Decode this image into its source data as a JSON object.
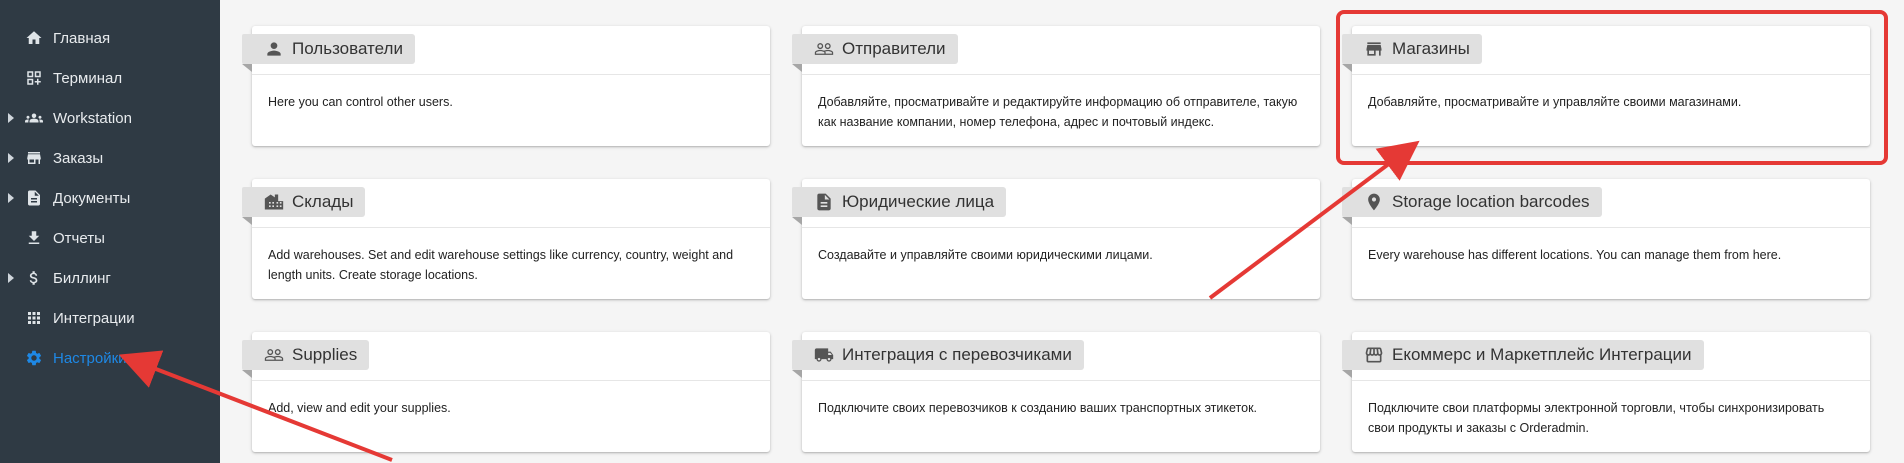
{
  "sidebar": {
    "items": [
      {
        "label": "Главная",
        "icon": "home-icon",
        "expandable": false,
        "active": false
      },
      {
        "label": "Терминал",
        "icon": "qr-code-icon",
        "expandable": false,
        "active": false
      },
      {
        "label": "Workstation",
        "icon": "group-icon",
        "expandable": true,
        "active": false
      },
      {
        "label": "Заказы",
        "icon": "store-icon",
        "expandable": true,
        "active": false
      },
      {
        "label": "Документы",
        "icon": "document-icon",
        "expandable": true,
        "active": false
      },
      {
        "label": "Отчеты",
        "icon": "download-icon",
        "expandable": false,
        "active": false
      },
      {
        "label": "Биллинг",
        "icon": "dollar-icon",
        "expandable": true,
        "active": false
      },
      {
        "label": "Интеграции",
        "icon": "apps-grid-icon",
        "expandable": false,
        "active": false
      },
      {
        "label": "Настройки",
        "icon": "gear-icon",
        "expandable": false,
        "active": true
      }
    ]
  },
  "cards": [
    {
      "title": "Пользователи",
      "icon": "person-icon",
      "description": "Here you can control other users."
    },
    {
      "title": "Отправители",
      "icon": "people-outline-icon",
      "description": "Добавляйте, просматривайте и редактируйте информацию об отправителе, такую как название компании, номер телефона, адрес и почтовый индекс."
    },
    {
      "title": "Магазины",
      "icon": "store-icon",
      "description": "Добавляйте, просматривайте и управляйте своими магазинами."
    },
    {
      "title": "Склады",
      "icon": "warehouse-icon",
      "description": "Add warehouses. Set and edit warehouse settings like currency, country, weight and length units. Create storage locations."
    },
    {
      "title": "Юридические лица",
      "icon": "document-icon",
      "description": "Создавайте и управляйте своими юридическими лицами."
    },
    {
      "title": "Storage location barcodes",
      "icon": "location-pin-icon",
      "description": "Every warehouse has different locations. You can manage them from here."
    },
    {
      "title": "Supplies",
      "icon": "people-outline-icon",
      "description": "Add, view and edit your supplies."
    },
    {
      "title": "Интеграция с перевозчиками",
      "icon": "truck-icon",
      "description": "Подключите своих перевозчиков к созданию ваших транспортных этикеток."
    },
    {
      "title": "Екоммерс и Маркетплейс Интеграции",
      "icon": "storefront-icon",
      "description": "Подключите свои платформы электронной торговли, чтобы синхронизировать свои продукты и заказы с Orderadmin."
    }
  ],
  "annotation": {
    "color": "#e53935"
  }
}
